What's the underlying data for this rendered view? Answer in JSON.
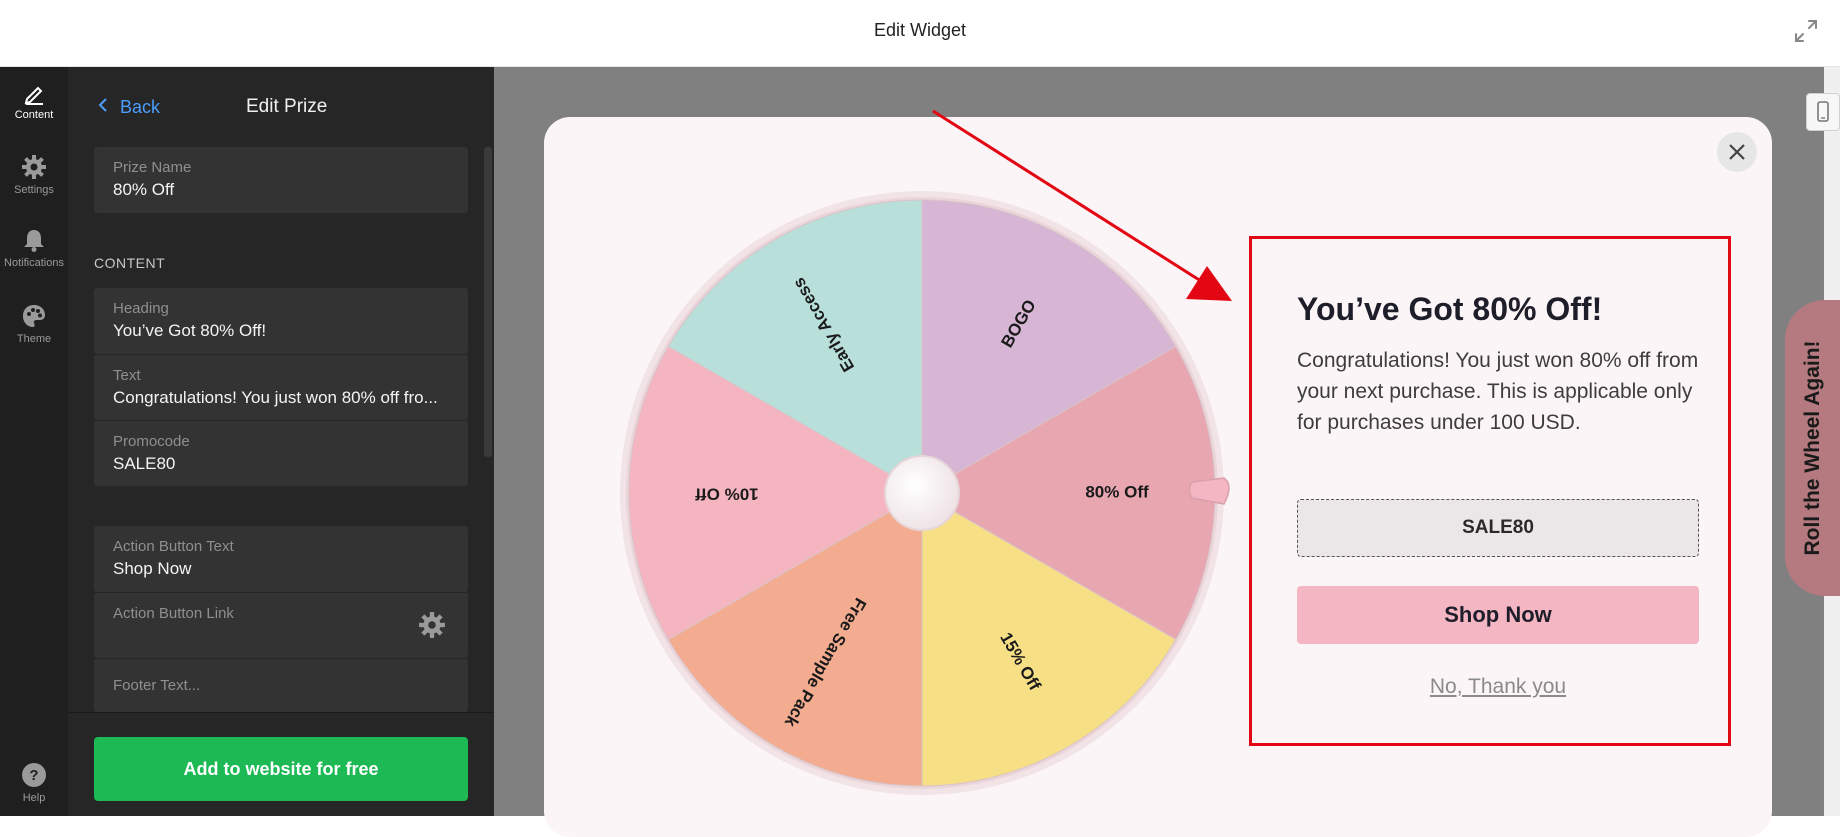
{
  "window": {
    "title": "Edit Widget"
  },
  "rail": {
    "items": [
      {
        "label": "Content",
        "icon": "pencil-icon"
      },
      {
        "label": "Settings",
        "icon": "gear-icon"
      },
      {
        "label": "Notifications",
        "icon": "bell-icon"
      },
      {
        "label": "Theme",
        "icon": "palette-icon"
      }
    ],
    "help": "Help"
  },
  "panel": {
    "back": "Back",
    "title": "Edit Prize",
    "prize_name": {
      "label": "Prize Name",
      "value": "80% Off"
    },
    "section": "CONTENT",
    "heading": {
      "label": "Heading",
      "value": "You’ve Got 80% Off!"
    },
    "text": {
      "label": "Text",
      "value": "Congratulations! You just won 80% off fro..."
    },
    "promocode": {
      "label": "Promocode",
      "value": "SALE80"
    },
    "action_text": {
      "label": "Action Button Text",
      "value": "Shop Now"
    },
    "action_link": {
      "label": "Action Button Link",
      "value": ""
    },
    "footer_text": {
      "placeholder": "Footer Text..."
    },
    "add_button": "Add to website for free"
  },
  "wheel": {
    "segments": [
      {
        "label": "BOGO",
        "color": "#d6b6d4"
      },
      {
        "label": "80% Off",
        "color": "#e8a6b0"
      },
      {
        "label": "15% Off",
        "color": "#f7df86"
      },
      {
        "label": "Free Sample Pack",
        "color": "#f4ac90"
      },
      {
        "label": "10% Off",
        "color": "#f5b5c0"
      },
      {
        "label": "Early Access",
        "color": "#b9dfdb"
      }
    ]
  },
  "result": {
    "heading": "You’ve Got 80% Off!",
    "text": "Congratulations! You just won 80% off from your next purchase. This is applicable only for purchases under 100 USD.",
    "code": "SALE80",
    "button": "Shop Now",
    "decline": "No, Thank you"
  },
  "side_tab": "Roll the Wheel Again!",
  "colors": {
    "accent_link": "#4a9eff",
    "add_button": "#1db954",
    "highlight_border": "#e30613",
    "annotation_arrow": "#e30613"
  }
}
